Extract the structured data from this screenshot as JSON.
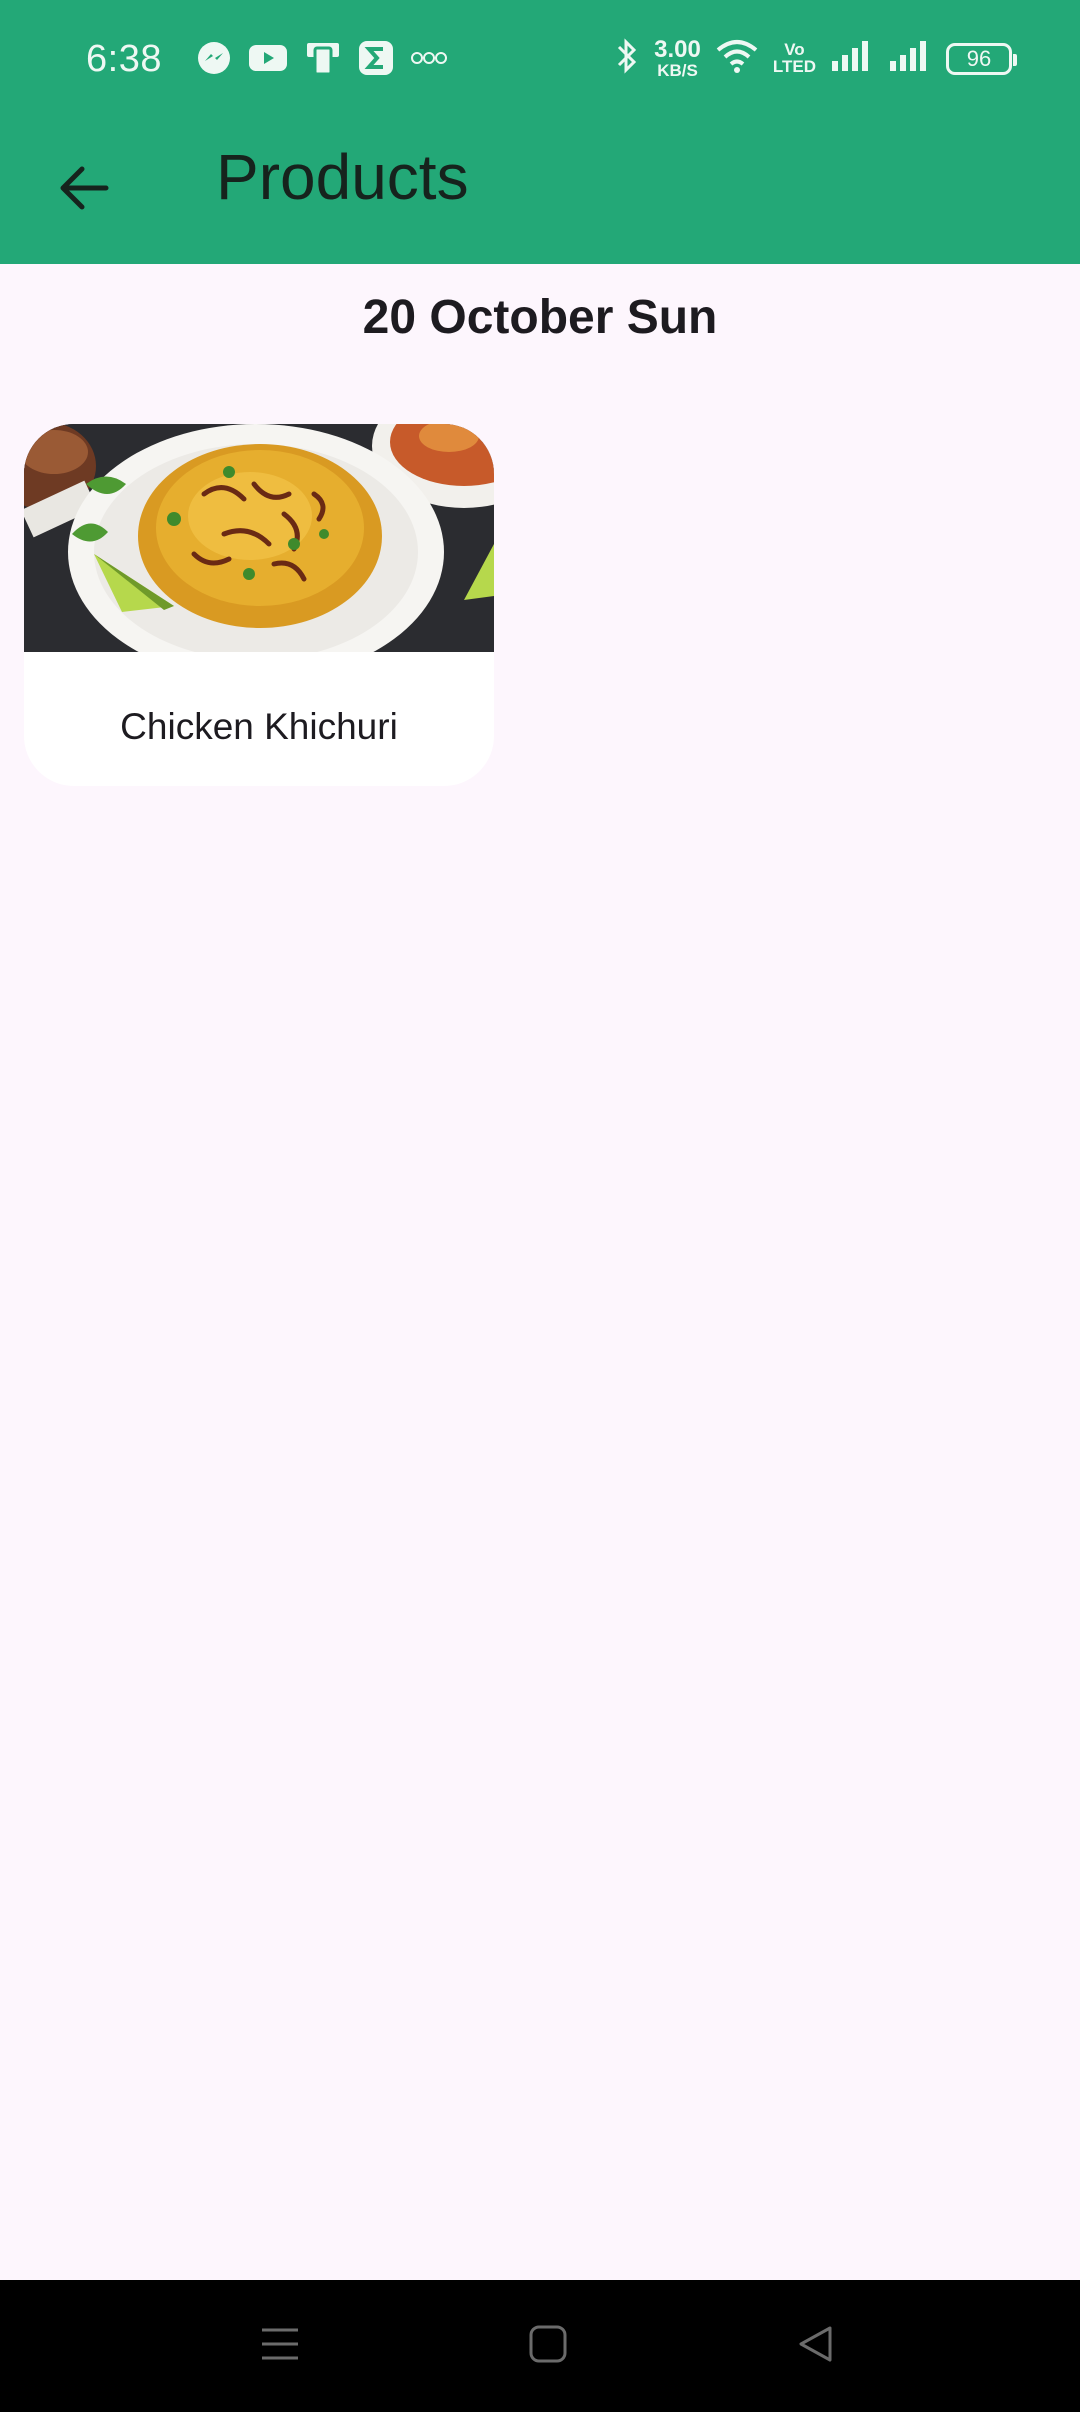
{
  "status_bar": {
    "time": "6:38",
    "net_speed_value": "3.00",
    "net_speed_unit": "KB/S",
    "volte_line1": "Vo",
    "volte_line2": "LTED",
    "battery": "96",
    "left_icons": [
      "messenger-icon",
      "youtube-icon",
      "device-icon",
      "sigma-app-icon",
      "more-notifications-icon"
    ],
    "right_icons": [
      "bluetooth-icon",
      "wifi-icon",
      "signal-icon",
      "signal-icon"
    ]
  },
  "app_bar": {
    "title": "Products",
    "back_icon": "arrow-left-icon"
  },
  "date_heading": "20 October Sun",
  "products": [
    {
      "name": "Chicken Khichuri"
    }
  ],
  "nav_bar": {
    "icons": [
      "menu-icon",
      "home-icon",
      "back-triangle-icon"
    ]
  },
  "colors": {
    "app_bar": "#23a877",
    "background": "#fdf6fd",
    "card": "#ffffff",
    "nav_bar": "#000000"
  }
}
